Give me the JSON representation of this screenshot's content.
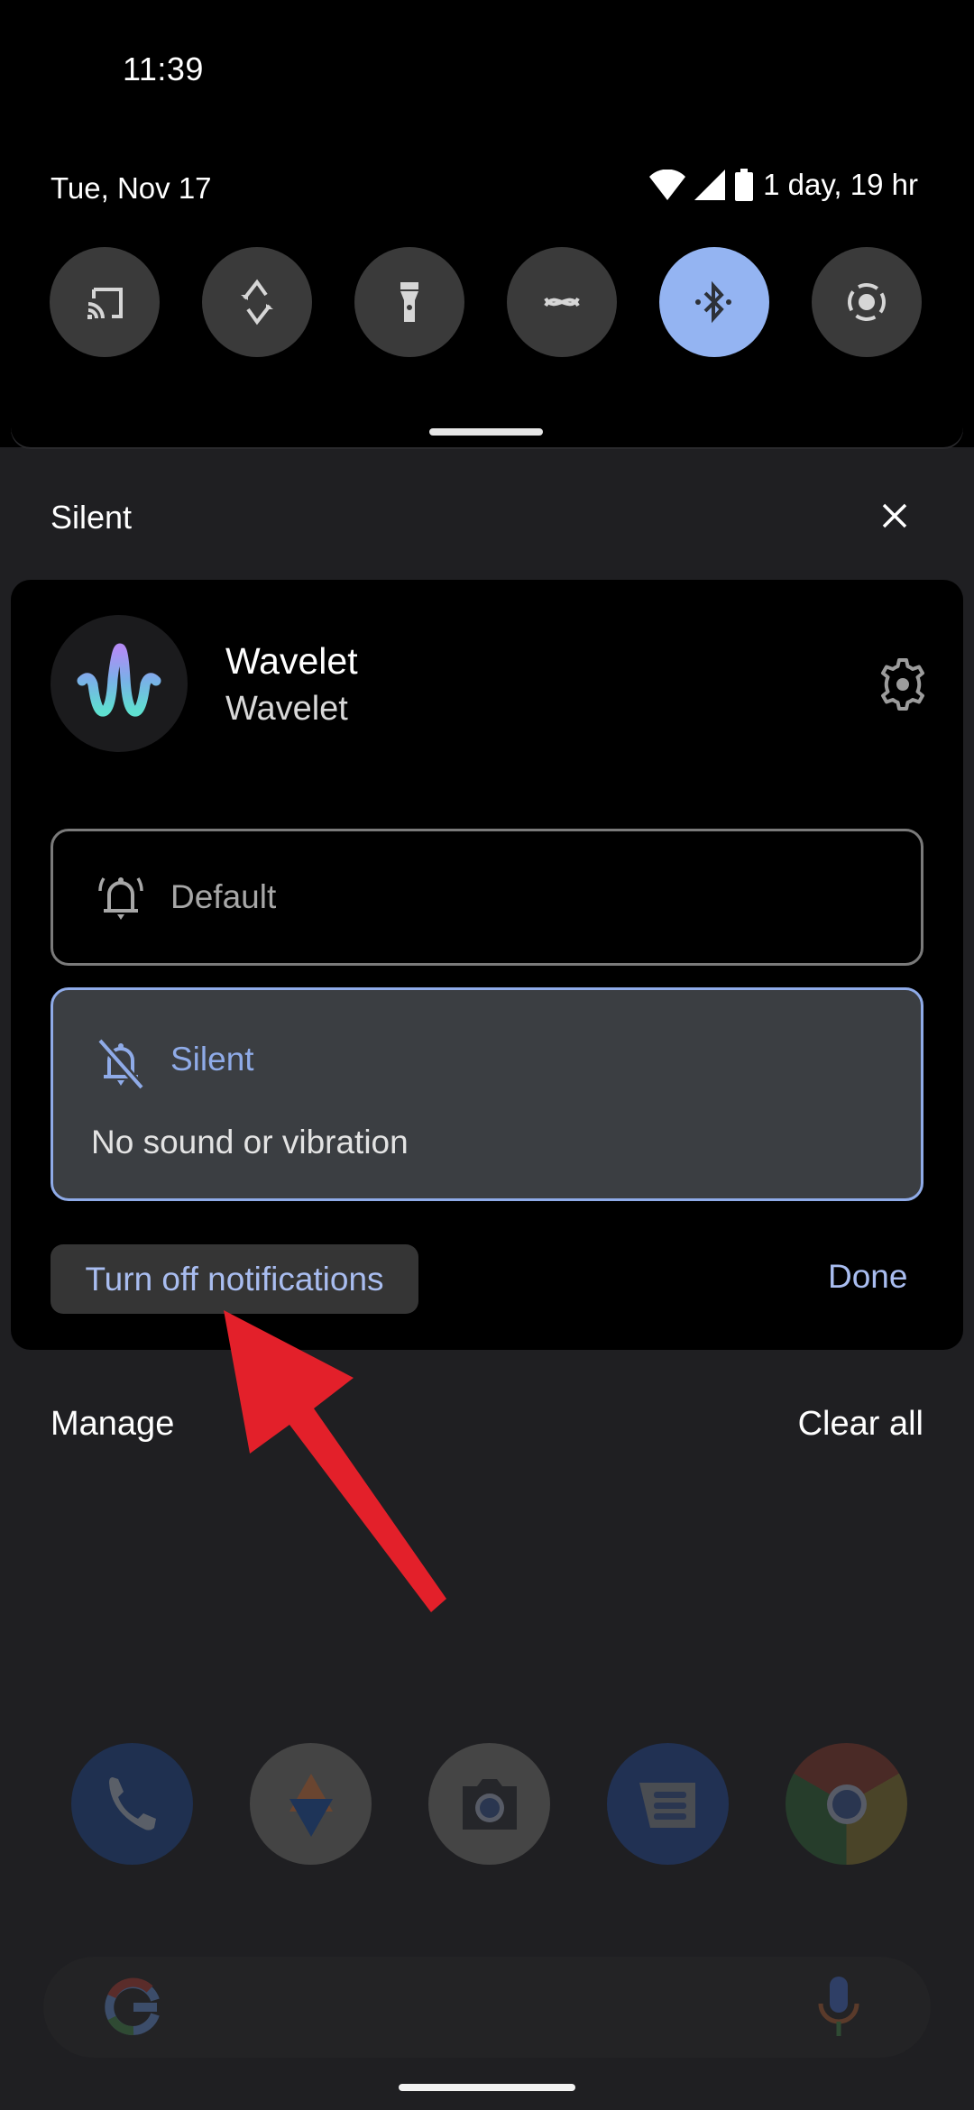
{
  "status_bar": {
    "time": "11:39",
    "date": "Tue, Nov 17",
    "battery_text": "1 day, 19 hr",
    "icons": [
      "wifi-icon",
      "cell-signal-icon",
      "battery-icon"
    ]
  },
  "quick_settings": {
    "tiles": [
      {
        "name": "cast",
        "icon": "cast-icon",
        "active": false
      },
      {
        "name": "auto-rotate",
        "icon": "rotate-icon",
        "active": false
      },
      {
        "name": "flashlight",
        "icon": "flashlight-icon",
        "active": false
      },
      {
        "name": "data-saver",
        "icon": "data-saver-icon",
        "active": false
      },
      {
        "name": "bluetooth",
        "icon": "bluetooth-icon",
        "active": true
      },
      {
        "name": "screen-record",
        "icon": "screen-record-icon",
        "active": false
      }
    ],
    "active_color": "#94b4f2"
  },
  "section": {
    "title": "Silent",
    "close_icon": "close-icon"
  },
  "notification": {
    "app_name": "Wavelet",
    "subtitle": "Wavelet",
    "settings_icon": "gear-icon",
    "options": [
      {
        "label": "Default",
        "icon": "bell-icon",
        "selected": false
      },
      {
        "label": "Silent",
        "icon": "bell-off-icon",
        "selected": true,
        "description": "No sound or vibration"
      }
    ],
    "turn_off_label": "Turn off notifications",
    "done_label": "Done",
    "accent_color": "#a9bdf0"
  },
  "footer": {
    "manage_label": "Manage",
    "clear_all_label": "Clear all"
  },
  "home_screen": {
    "dock_apps": [
      "phone",
      "photos",
      "camera",
      "messages",
      "chrome"
    ],
    "search_icons": [
      "google-g-icon",
      "microphone-icon"
    ]
  },
  "annotation": {
    "type": "arrow",
    "color": "#e3202a",
    "points_to": "Turn off notifications"
  }
}
